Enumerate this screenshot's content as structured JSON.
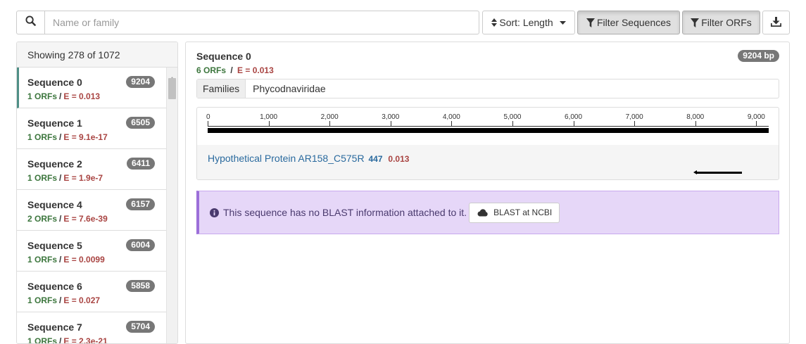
{
  "search": {
    "placeholder": "Name or family",
    "value": ""
  },
  "toolbar": {
    "sort_label": "Sort: Length",
    "filter_sequences_label": "Filter Sequences",
    "filter_orfs_label": "Filter ORFs"
  },
  "sequence_list": {
    "header": "Showing 278 of 1072",
    "items": [
      {
        "name": "Sequence 0",
        "length": "9204",
        "orfs": "1 ORFs",
        "evalue": "E = 0.013",
        "selected": true
      },
      {
        "name": "Sequence 1",
        "length": "6505",
        "orfs": "1 ORFs",
        "evalue": "E = 9.1e-17"
      },
      {
        "name": "Sequence 2",
        "length": "6411",
        "orfs": "1 ORFs",
        "evalue": "E = 1.9e-7"
      },
      {
        "name": "Sequence 4",
        "length": "6157",
        "orfs": "2 ORFs",
        "evalue": "E = 7.6e-39"
      },
      {
        "name": "Sequence 5",
        "length": "6004",
        "orfs": "1 ORFs",
        "evalue": "E = 0.0099"
      },
      {
        "name": "Sequence 6",
        "length": "5858",
        "orfs": "1 ORFs",
        "evalue": "E = 0.027"
      },
      {
        "name": "Sequence 7",
        "length": "5704",
        "orfs": "1 ORFs",
        "evalue": "E = 2.3e-21"
      }
    ]
  },
  "detail": {
    "title": "Sequence 0",
    "length_badge": "9204 bp",
    "orfs": "6 ORFs",
    "separator": "/",
    "evalue": "E = 0.013",
    "families_label": "Families",
    "families_value": "Phycodnaviridae",
    "ruler": {
      "max": 9204,
      "ticks": [
        {
          "value": 0,
          "label": "0"
        },
        {
          "value": 1000,
          "label": "1,000"
        },
        {
          "value": 2000,
          "label": "2,000"
        },
        {
          "value": 3000,
          "label": "3,000"
        },
        {
          "value": 4000,
          "label": "4,000"
        },
        {
          "value": 5000,
          "label": "5,000"
        },
        {
          "value": 6000,
          "label": "6,000"
        },
        {
          "value": 7000,
          "label": "7,000"
        },
        {
          "value": 8000,
          "label": "8,000"
        },
        {
          "value": 9000,
          "label": "9,000"
        }
      ]
    },
    "orf": {
      "name": "Hypothetical Protein AR158_C575R",
      "length": "447",
      "evalue": "0.013",
      "start": 7980,
      "end": 8770,
      "strand": "reverse"
    },
    "blast_message": "This sequence has no BLAST information attached to it.",
    "blast_button": "BLAST at NCBI"
  },
  "colors": {
    "orf_count": "#3c763d",
    "evalue": "#a94442",
    "badge": "#777777",
    "alert_bg": "#e6d7f8",
    "selected_accent": "#4f8f86"
  },
  "icons": {
    "search": "search-icon",
    "sort": "sort-icon",
    "filter": "filter-icon",
    "download": "download-icon",
    "info": "info-circle-icon",
    "cloud": "cloud-icon"
  }
}
